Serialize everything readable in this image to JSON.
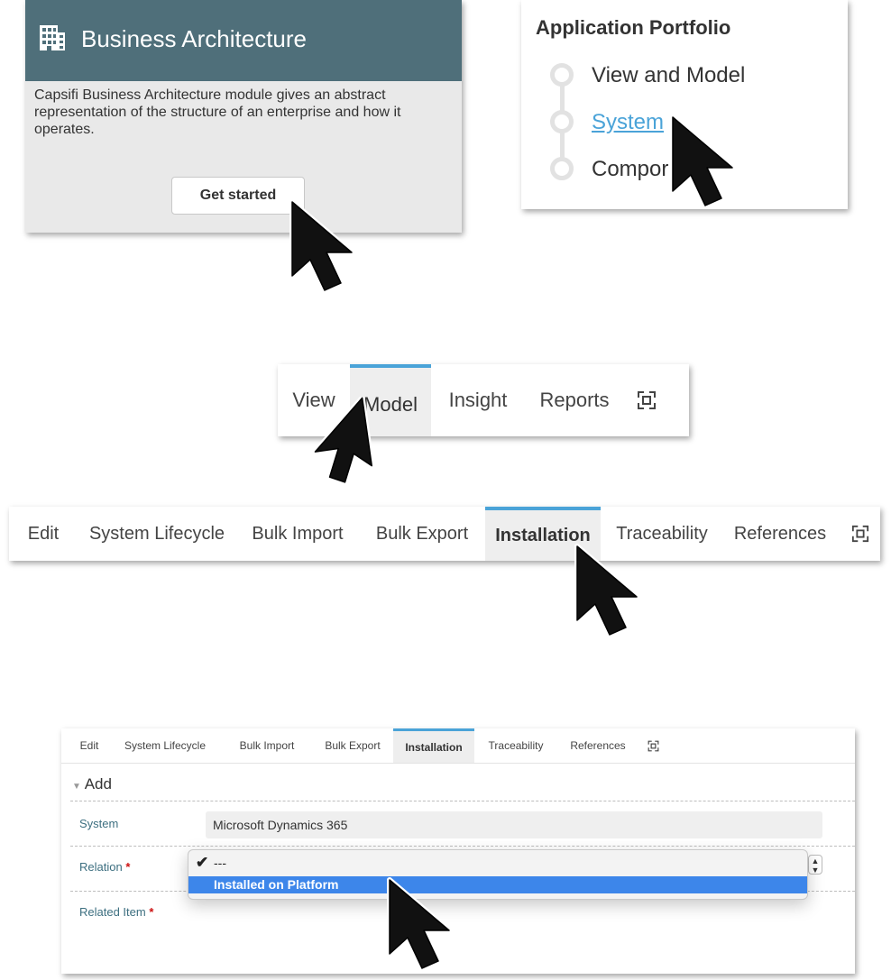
{
  "business_card": {
    "title": "Business Architecture",
    "description": "Capsifi Business Architecture module gives an abstract representation of the structure of an enterprise and how it operates.",
    "button": "Get started",
    "header_color": "#4f6f7a",
    "icon": "building-icon"
  },
  "portfolio_card": {
    "title": "Application Portfolio",
    "items": [
      {
        "label": "View and Model"
      },
      {
        "label": "System"
      },
      {
        "label": "Compor"
      }
    ],
    "link_color": "#4aa3d8"
  },
  "top_tabs": {
    "items": [
      "View",
      "Model",
      "Insight",
      "Reports"
    ],
    "active": "Model",
    "expand_icon": "expand-icon"
  },
  "system_tabs": {
    "items": [
      "Edit",
      "System Lifecycle",
      "Bulk Import",
      "Bulk Export",
      "Installation",
      "Traceability",
      "References"
    ],
    "active": "Installation",
    "expand_icon": "expand-icon"
  },
  "form": {
    "tabs": [
      "Edit",
      "System Lifecycle",
      "Bulk Import",
      "Bulk Export",
      "Installation",
      "Traceability",
      "References"
    ],
    "active_tab": "Installation",
    "section": "Add",
    "system_label": "System",
    "system_value": "Microsoft Dynamics 365",
    "relation_label": "Relation",
    "related_item_label": "Related Item",
    "required_mark": "*",
    "dropdown_options": [
      {
        "label": "---",
        "checked": true
      },
      {
        "label": "Installed on Platform",
        "highlighted": true
      }
    ],
    "highlight_color": "#3d86ea",
    "label_color": "#3d6f80"
  }
}
